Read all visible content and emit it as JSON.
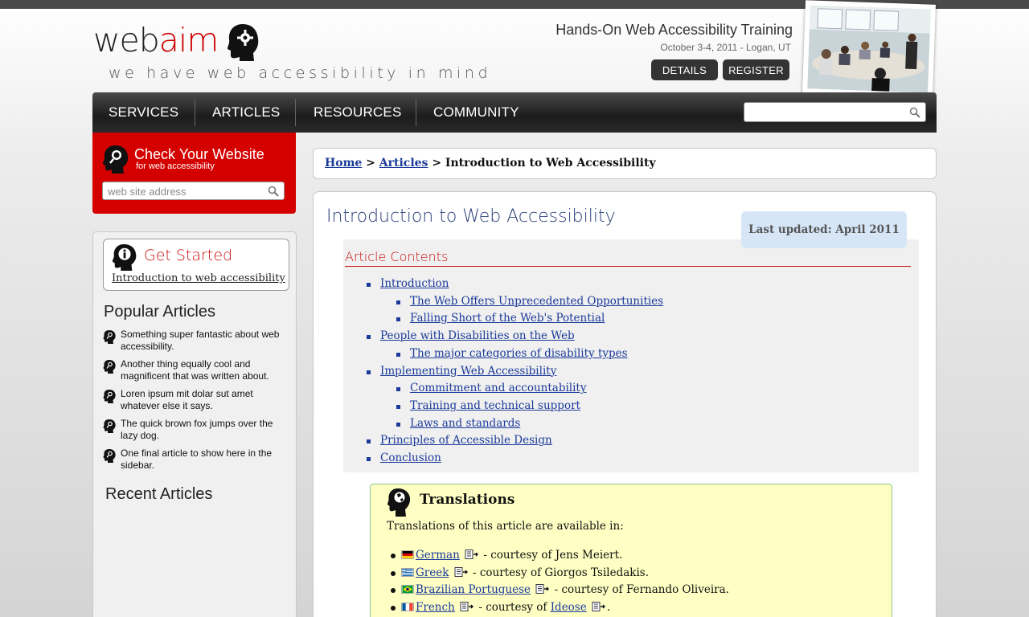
{
  "header": {
    "logo_part1": "web",
    "logo_part2": "aim",
    "tagline": "we have web accessibility in mind",
    "promo_title": "Hands-On Web Accessibility Training",
    "promo_date": "October 3-4, 2011 - Logan, UT",
    "details_label": "DETAILS",
    "register_label": "REGISTER"
  },
  "nav": {
    "items": [
      "SERVICES",
      "ARTICLES",
      "RESOURCES",
      "COMMUNITY"
    ],
    "search_value": ""
  },
  "check": {
    "title": "Check Your Website",
    "subtitle": "for web accessibility",
    "placeholder": "web site address"
  },
  "sidebar": {
    "get_started_title": "Get Started",
    "get_started_link": "Introduction to web accessibility",
    "popular_heading": "Popular Articles",
    "popular": [
      "Something super fantastic about web accessibility.",
      "Another thing equally cool and magnificent that was written about.",
      "Loren ipsum mit dolar sut amet whatever else it says.",
      "The quick brown fox jumps over the lazy dog.",
      "One final article to show here in the sidebar."
    ],
    "recent_heading": "Recent Articles"
  },
  "breadcrumb": {
    "home": "Home",
    "sep": ">",
    "articles": "Articles",
    "current": "Introduction to Web Accessibility"
  },
  "main": {
    "title": "Introduction to Web Accessibility",
    "updated": "Last updated: April 2011",
    "toc_title": "Article Contents",
    "toc": [
      {
        "label": "Introduction",
        "level": 1
      },
      {
        "label": "The Web Offers Unprecedented Opportunities",
        "level": 2
      },
      {
        "label": "Falling Short of the Web's Potential",
        "level": 2
      },
      {
        "label": "People with Disabilities on the Web",
        "level": 1
      },
      {
        "label": "The major categories of disability types",
        "level": 2
      },
      {
        "label": "Implementing Web Accessibility",
        "level": 1
      },
      {
        "label": "Commitment and accountability",
        "level": 2
      },
      {
        "label": "Training and technical support",
        "level": 2
      },
      {
        "label": "Laws and standards",
        "level": 2
      },
      {
        "label": "Principles of Accessible Design",
        "level": 1
      },
      {
        "label": "Conclusion",
        "level": 1
      }
    ],
    "translations_title": "Translations",
    "translations_intro": "Translations of this article are available in:",
    "translations": [
      {
        "lang": "German",
        "credit": " - courtesy of Jens Meiert."
      },
      {
        "lang": "Greek",
        "credit": " - courtesy of Giorgos Tsiledakis."
      },
      {
        "lang": "Brazilian Portuguese",
        "credit": " - courtesy of Fernando Oliveira."
      },
      {
        "lang": "French",
        "credit_prefix": " - courtesy of ",
        "credit_link": "Ideose",
        "credit_suffix": "."
      }
    ]
  },
  "colors": {
    "accent_red": "#d40000",
    "link_blue": "#1a3a99",
    "nav_dark": "#1c1c1c",
    "translation_bg": "#ffffc4"
  }
}
